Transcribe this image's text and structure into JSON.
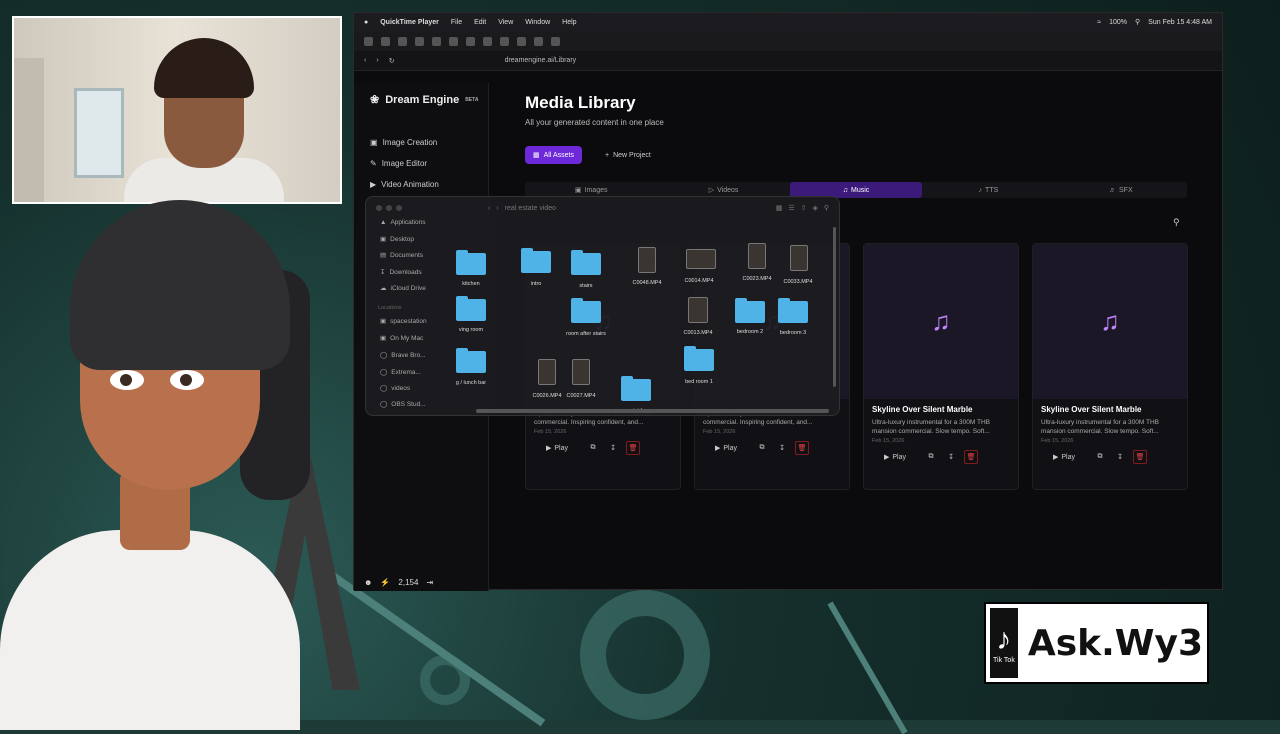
{
  "menubar": {
    "app": "QuickTime Player",
    "items": [
      "File",
      "Edit",
      "View",
      "Window",
      "Help"
    ],
    "battery": "100%",
    "clock": "Sun Feb 15 4:48 AM"
  },
  "browser": {
    "url": "dreamengine.ai/Library"
  },
  "sidebar": {
    "brand": "Dream Engine",
    "brand_tag": "BETA",
    "items": [
      {
        "label": "Image Creation",
        "icon": "image-icon"
      },
      {
        "label": "Image Editor",
        "icon": "edit-icon"
      },
      {
        "label": "Video Animation",
        "icon": "video-icon"
      }
    ],
    "credits": "2,154"
  },
  "library": {
    "title": "Media Library",
    "subtitle": "All your generated content in one place",
    "all_assets": "All Assets",
    "new_project": "New Project",
    "tabs": [
      {
        "label": "Images",
        "icon": "image-icon"
      },
      {
        "label": "Videos",
        "icon": "video-icon"
      },
      {
        "label": "Music",
        "icon": "music-icon"
      },
      {
        "label": "TTS",
        "icon": "tts-icon"
      },
      {
        "label": "SFX",
        "icon": "sfx-icon"
      }
    ],
    "cards": [
      {
        "title": "",
        "desc": "Upbeat luxury instrumental for a mansion commercial. Inspiring confident, and...",
        "date": "Feb 15, 2026",
        "play": "Play"
      },
      {
        "title": "",
        "desc": "Upbeat luxury instrumental for a mansion commercial. Inspiring confident, and...",
        "date": "Feb 15, 2026",
        "play": "Play"
      },
      {
        "title": "Skyline Over Silent Marble",
        "desc": "Ultra-luxury instrumental for a 300M THB mansion commercial. Slow tempo. Soft...",
        "date": "Feb 15, 2026",
        "play": "Play"
      },
      {
        "title": "Skyline Over Silent Marble",
        "desc": "Ultra-luxury instrumental for a 300M THB mansion commercial. Slow tempo. Soft...",
        "date": "Feb 15, 2026",
        "play": "Play"
      }
    ]
  },
  "finder": {
    "path": "real estate video",
    "sidebar": [
      "Applications",
      "Desktop",
      "Documents",
      "Downloads",
      "iCloud Drive"
    ],
    "locations_label": "Locations",
    "locations": [
      "spacestation",
      "On My Mac",
      "Brave Bro...",
      "Extrema...",
      "videos",
      "OBS Stud..."
    ],
    "files": {
      "kitchen": "kitchen",
      "intro": "intro",
      "stairs": "stairs",
      "c0048": "C0048.MP4",
      "c0014": "C0014.MP4",
      "c0023": "C0023.MP4",
      "c0033": "C0033.MP4",
      "living": "ving room",
      "room_after": "room after stairs",
      "c0013": "C0013.MP4",
      "bedroom2": "bedroom 2",
      "bedroom3": "bedroom 3",
      "lunch": "g / lunch bar",
      "c0026": "C0026.MP4",
      "c0027": "C0027.MP4",
      "outside": "outside",
      "bedroom1": "bed room 1"
    }
  },
  "overlay": {
    "tiktok_label": "Tik Tok",
    "handle": "Ask.Wy3"
  }
}
